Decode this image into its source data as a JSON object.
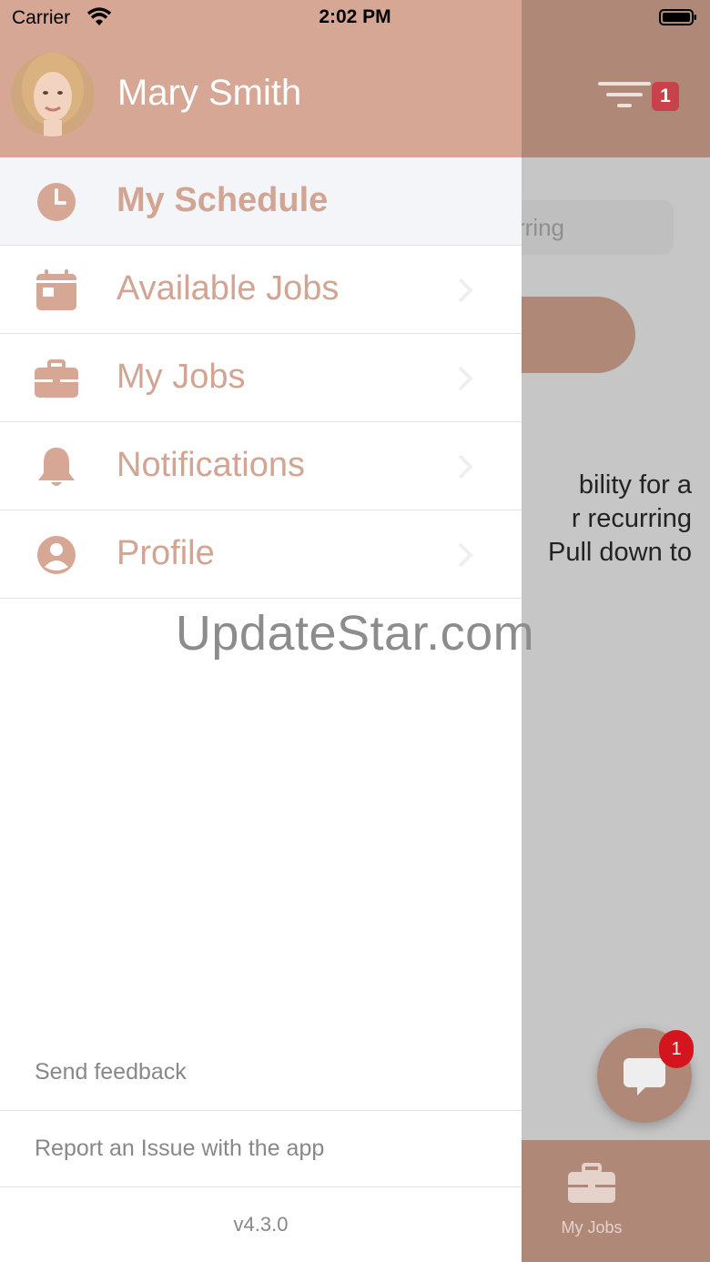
{
  "status_bar": {
    "carrier": "Carrier",
    "time": "2:02 PM"
  },
  "background": {
    "search_placeholder_partial": "rring",
    "message_lines": [
      "bility for a",
      "r recurring",
      "Pull down to"
    ],
    "filter_badge": "1",
    "chat_badge": "1",
    "tab_label": "My Jobs"
  },
  "drawer": {
    "user_name": "Mary Smith",
    "menu": [
      {
        "label": "My Schedule",
        "icon": "clock-icon",
        "active": true
      },
      {
        "label": "Available Jobs",
        "icon": "calendar-icon"
      },
      {
        "label": "My Jobs",
        "icon": "briefcase-icon"
      },
      {
        "label": "Notifications",
        "icon": "bell-icon"
      },
      {
        "label": "Profile",
        "icon": "user-circle-icon"
      }
    ],
    "footer": {
      "send_feedback": "Send feedback",
      "report_issue": "Report an Issue with the app",
      "version": "v4.3.0"
    }
  },
  "watermark": "UpdateStar.com",
  "colors": {
    "accent": "#d5a794",
    "accent_dim": "#b08877",
    "menu_text": "#d2a593",
    "badge_red": "#c9414a"
  }
}
